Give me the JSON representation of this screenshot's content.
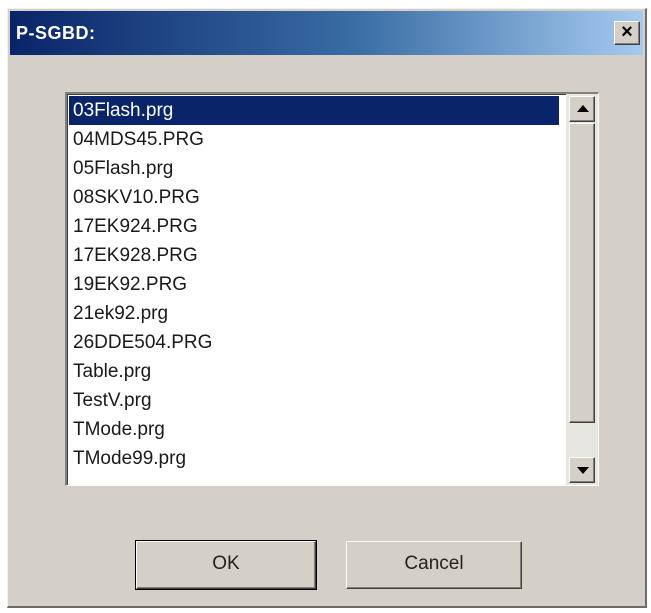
{
  "window": {
    "title": "P-SGBD:",
    "close_glyph": "×",
    "close_icon": "close-icon"
  },
  "file_list": {
    "selected_index": 0,
    "items": [
      "03Flash.prg",
      "04MDS45.PRG",
      "05Flash.prg",
      "08SKV10.PRG",
      "17EK924.PRG",
      "17EK928.PRG",
      "19EK92.PRG",
      "21ek92.prg",
      "26DDE504.PRG",
      "Table.prg",
      "TestV.prg",
      "TMode.prg",
      "TMode99.prg"
    ]
  },
  "buttons": {
    "ok_label": "OK",
    "cancel_label": "Cancel"
  },
  "colors": {
    "selection": "#0a246a",
    "titlebar_start": "#0a246a",
    "titlebar_end": "#a6caf0",
    "dialog_face": "#d4d0c8"
  }
}
